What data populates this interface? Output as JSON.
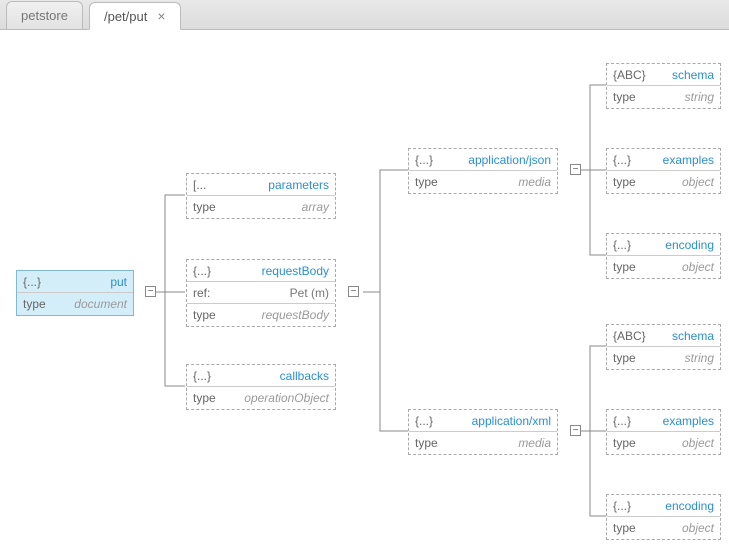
{
  "tabs": [
    {
      "label": "petstore",
      "active": false,
      "closable": false
    },
    {
      "label": "/pet/put",
      "active": true,
      "closable": true
    }
  ],
  "nodes": {
    "root": {
      "icon": "{...}",
      "title": "put",
      "rows": [
        [
          "type",
          "document"
        ]
      ]
    },
    "params": {
      "icon": "[...",
      "title": "parameters",
      "rows": [
        [
          "type",
          "array"
        ]
      ]
    },
    "reqbody": {
      "icon": "{...}",
      "title": "requestBody",
      "rows": [
        [
          "ref:",
          "Pet (m)",
          "plain"
        ],
        [
          "type",
          "requestBody"
        ]
      ]
    },
    "callbacks": {
      "icon": "{...}",
      "title": "callbacks",
      "rows": [
        [
          "type",
          "operationObject"
        ]
      ]
    },
    "appjson": {
      "icon": "{...}",
      "title": "application/json",
      "rows": [
        [
          "type",
          "media"
        ]
      ]
    },
    "appxml": {
      "icon": "{...}",
      "title": "application/xml",
      "rows": [
        [
          "type",
          "media"
        ]
      ]
    },
    "schema1": {
      "icon": "{ABC}",
      "title": "schema",
      "rows": [
        [
          "type",
          "string"
        ]
      ]
    },
    "examples1": {
      "icon": "{...}",
      "title": "examples",
      "rows": [
        [
          "type",
          "object"
        ]
      ]
    },
    "encoding1": {
      "icon": "{...}",
      "title": "encoding",
      "rows": [
        [
          "type",
          "object"
        ]
      ]
    },
    "schema2": {
      "icon": "{ABC}",
      "title": "schema",
      "rows": [
        [
          "type",
          "string"
        ]
      ]
    },
    "examples2": {
      "icon": "{...}",
      "title": "examples",
      "rows": [
        [
          "type",
          "object"
        ]
      ]
    },
    "encoding2": {
      "icon": "{...}",
      "title": "encoding",
      "rows": [
        [
          "type",
          "object"
        ]
      ]
    }
  },
  "toggleGlyph": "−"
}
